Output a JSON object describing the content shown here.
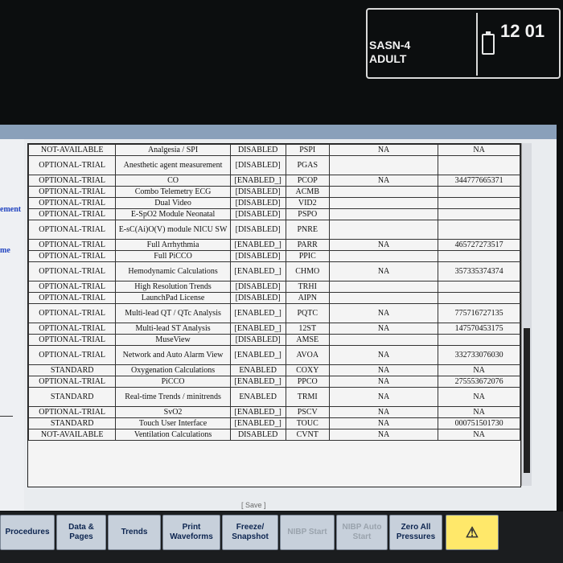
{
  "status": {
    "patient_id": "SASN-4",
    "patient_type": "ADULT",
    "time": "12 01",
    "battery_icon": "battery-icon"
  },
  "left_panel": {
    "label1": "ement",
    "label2": "me"
  },
  "table": {
    "rows": [
      {
        "status": "NOT-AVAILABLE",
        "feature": "Analgesia / SPI",
        "state": "DISABLED",
        "code": "PSPI",
        "val1": "NA",
        "val2": "NA"
      },
      {
        "status": "OPTIONAL-TRIAL",
        "feature": "Anesthetic agent measurement",
        "state": "[DISABLED]",
        "code": "PGAS",
        "val1": "",
        "val2": ""
      },
      {
        "status": "OPTIONAL-TRIAL",
        "feature": "CO",
        "state": "[ENABLED_]",
        "code": "PCOP",
        "val1": "NA",
        "val2": "344777665371"
      },
      {
        "status": "OPTIONAL-TRIAL",
        "feature": "Combo Telemetry ECG",
        "state": "[DISABLED]",
        "code": "ACMB",
        "val1": "",
        "val2": ""
      },
      {
        "status": "OPTIONAL-TRIAL",
        "feature": "Dual Video",
        "state": "[DISABLED]",
        "code": "VID2",
        "val1": "",
        "val2": ""
      },
      {
        "status": "OPTIONAL-TRIAL",
        "feature": "E-SpO2 Module Neonatal",
        "state": "[DISABLED]",
        "code": "PSPO",
        "val1": "",
        "val2": ""
      },
      {
        "status": "OPTIONAL-TRIAL",
        "feature": "E-sC(Ai)O(V) module NICU SW",
        "state": "[DISABLED]",
        "code": "PNRE",
        "val1": "",
        "val2": ""
      },
      {
        "status": "OPTIONAL-TRIAL",
        "feature": "Full Arrhythmia",
        "state": "[ENABLED_]",
        "code": "PARR",
        "val1": "NA",
        "val2": "465727273517"
      },
      {
        "status": "OPTIONAL-TRIAL",
        "feature": "Full PiCCO",
        "state": "[DISABLED]",
        "code": "PPIC",
        "val1": "",
        "val2": ""
      },
      {
        "status": "OPTIONAL-TRIAL",
        "feature": "Hemodynamic Calculations",
        "state": "[ENABLED_]",
        "code": "CHMO",
        "val1": "NA",
        "val2": "357335374374"
      },
      {
        "status": "OPTIONAL-TRIAL",
        "feature": "High Resolution Trends",
        "state": "[DISABLED]",
        "code": "TRHI",
        "val1": "",
        "val2": ""
      },
      {
        "status": "OPTIONAL-TRIAL",
        "feature": "LaunchPad License",
        "state": "[DISABLED]",
        "code": "AIPN",
        "val1": "",
        "val2": ""
      },
      {
        "status": "OPTIONAL-TRIAL",
        "feature": "Multi-lead QT / QTc Analysis",
        "state": "[ENABLED_]",
        "code": "PQTC",
        "val1": "NA",
        "val2": "775716727135"
      },
      {
        "status": "OPTIONAL-TRIAL",
        "feature": "Multi-lead ST Analysis",
        "state": "[ENABLED_]",
        "code": "12ST",
        "val1": "NA",
        "val2": "147570453175"
      },
      {
        "status": "OPTIONAL-TRIAL",
        "feature": "MuseView",
        "state": "[DISABLED]",
        "code": "AMSE",
        "val1": "",
        "val2": ""
      },
      {
        "status": "OPTIONAL-TRIAL",
        "feature": "Network and Auto Alarm View",
        "state": "[ENABLED_]",
        "code": "AVOA",
        "val1": "NA",
        "val2": "332733076030"
      },
      {
        "status": "STANDARD",
        "feature": "Oxygenation Calculations",
        "state": "ENABLED",
        "code": "COXY",
        "val1": "NA",
        "val2": "NA"
      },
      {
        "status": "OPTIONAL-TRIAL",
        "feature": "PiCCO",
        "state": "[ENABLED_]",
        "code": "PPCO",
        "val1": "NA",
        "val2": "275553672076"
      },
      {
        "status": "STANDARD",
        "feature": "Real-time Trends / minitrends",
        "state": "ENABLED",
        "code": "TRMI",
        "val1": "NA",
        "val2": "NA"
      },
      {
        "status": "OPTIONAL-TRIAL",
        "feature": "SvO2",
        "state": "[ENABLED_]",
        "code": "PSCV",
        "val1": "NA",
        "val2": "NA"
      },
      {
        "status": "STANDARD",
        "feature": "Touch User Interface",
        "state": "[ENABLED_]",
        "code": "TOUC",
        "val1": "NA",
        "val2": "000751501730"
      },
      {
        "status": "NOT-AVAILABLE",
        "feature": "Ventilation Calculations",
        "state": "DISABLED",
        "code": "CVNT",
        "val1": "NA",
        "val2": "NA"
      }
    ]
  },
  "save_label": "[ Save ]",
  "buttons": [
    {
      "label": "Procedures",
      "enabled": true
    },
    {
      "label": "Data & Pages",
      "enabled": true
    },
    {
      "label": "Trends",
      "enabled": true
    },
    {
      "label": "Print Waveforms",
      "enabled": true
    },
    {
      "label": "Freeze/ Snapshot",
      "enabled": true
    },
    {
      "label": "NIBP Start",
      "enabled": false
    },
    {
      "label": "NIBP Auto Start",
      "enabled": false
    },
    {
      "label": "Zero All Pressures",
      "enabled": true
    }
  ],
  "alarm_icon": "alarm-silence-icon"
}
